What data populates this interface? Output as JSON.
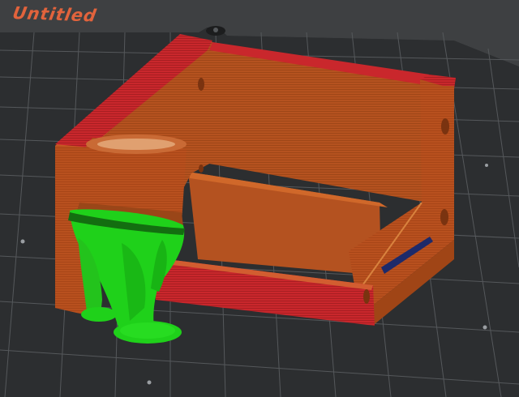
{
  "plate": {
    "label": "Untitled"
  },
  "colors": {
    "bed_background": "#3c3e40",
    "bed_plate": "#2b2d2f",
    "grid_line": "#5b5e61",
    "plate_label": "#e2633c",
    "model_body": "#b8501e",
    "model_top_edge": "#c9272c",
    "support": "#1fd11a"
  },
  "objects": [
    {
      "name": "enclosure-box",
      "color": "#b8501e"
    },
    {
      "name": "funnel-part",
      "color": "#b8501e"
    },
    {
      "name": "tree-supports",
      "color": "#1fd11a"
    }
  ]
}
